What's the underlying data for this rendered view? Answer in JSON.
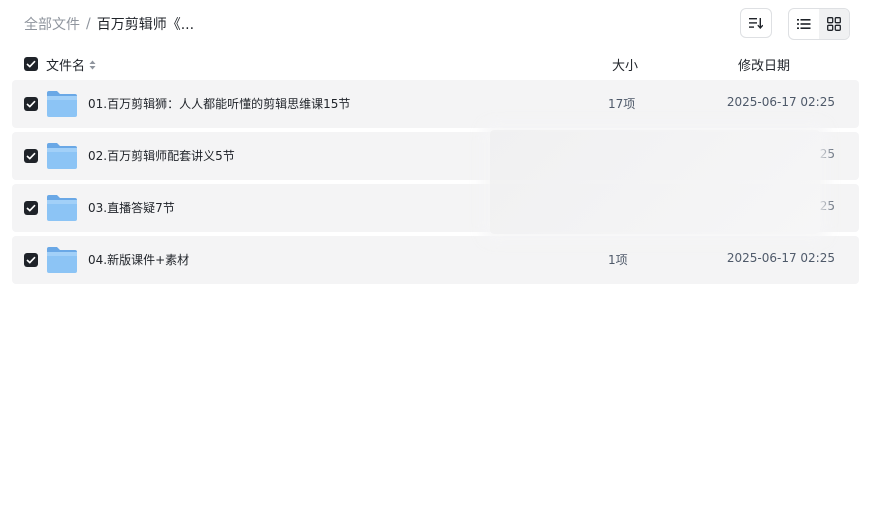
{
  "breadcrumb": {
    "root": "全部文件",
    "separator": "/",
    "current": "百万剪辑师《..."
  },
  "toolbar": {
    "sort_icon": "sort-icon",
    "list_view_icon": "list-view-icon",
    "grid_view_icon": "grid-view-icon",
    "active_view": "list"
  },
  "columns": {
    "name": "文件名",
    "size": "大小",
    "date": "修改日期"
  },
  "rows": [
    {
      "name": "01.百万剪辑狮：人人都能听懂的剪辑思维课15节",
      "size": "17项",
      "date": "2025-06-17 02:25",
      "checked": true
    },
    {
      "name": "02.百万剪辑师配套讲义5节",
      "size": "",
      "date": "25",
      "checked": true
    },
    {
      "name": "03.直播答疑7节",
      "size": "",
      "date": "25",
      "checked": true
    },
    {
      "name": "04.新版课件+素材",
      "size": "1项",
      "date": "2025-06-17 02:25",
      "checked": true
    }
  ],
  "colors": {
    "row_bg": "#f4f4f5",
    "checkbox": "#1f2329",
    "folder": "#7cb8ee"
  }
}
